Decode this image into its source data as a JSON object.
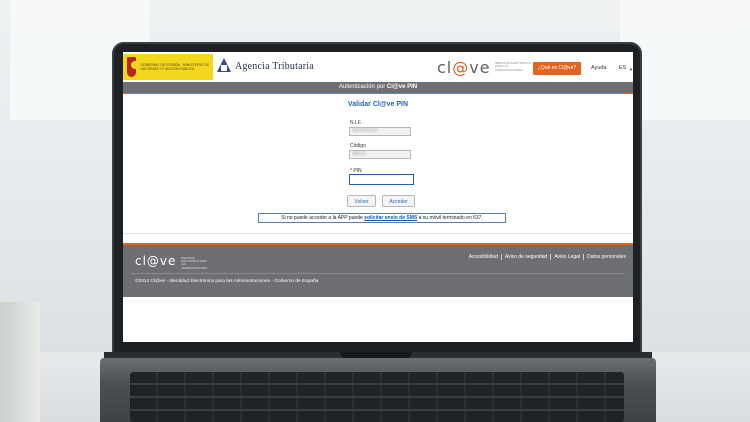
{
  "header": {
    "gov_logo_text": "GOBIERNO DE ESPAÑA · MINISTERIO DE HACIENDA Y FUNCIÓN PÚBLICA",
    "aeat_name": "Agencia Tributaria",
    "clave_logo": [
      "cl",
      "@",
      "ve"
    ],
    "clave_subtitle": "IDENTIDAD ELECTRÓNICA PARA LAS ADMINISTRACIONES",
    "que_es_label": "¿Qué es Cl@ve?",
    "ayuda_label": "Ayuda",
    "lang_label": "ES"
  },
  "titlebar": {
    "prefix": "Autenticación por ",
    "strong": "Cl@ve PIN"
  },
  "form": {
    "title": "Validar Cl@ve PIN",
    "nif_label": "N.I.F.",
    "nif_value": "00000000X",
    "codigo_label": "Código",
    "codigo_value": "ABCD",
    "pin_label": "* PIN",
    "pin_value": "",
    "volver_label": "Volver",
    "acceder_label": "Acceder",
    "sms_before": "Si no puede acceder a la APP puede ",
    "sms_link": "solicitar envío de SMS",
    "sms_after": " a su móvil terminado en 637."
  },
  "footer": {
    "logo": "cl@ve",
    "subtitle": "IDENTIDAD ELECTRÓNICA PARA LAS ADMINISTRACIONES",
    "links": [
      "Accesibilidad",
      "Aviso de seguridad",
      "Aviso Legal",
      "Datos personales"
    ],
    "copyright": "©2014 Cl@ve - Identidad Electrónica para las Administraciones - Gobierno de España"
  },
  "colors": {
    "accent": "#e3641e",
    "title_blue": "#2a66b0",
    "bar_gray": "#6d6f72"
  }
}
